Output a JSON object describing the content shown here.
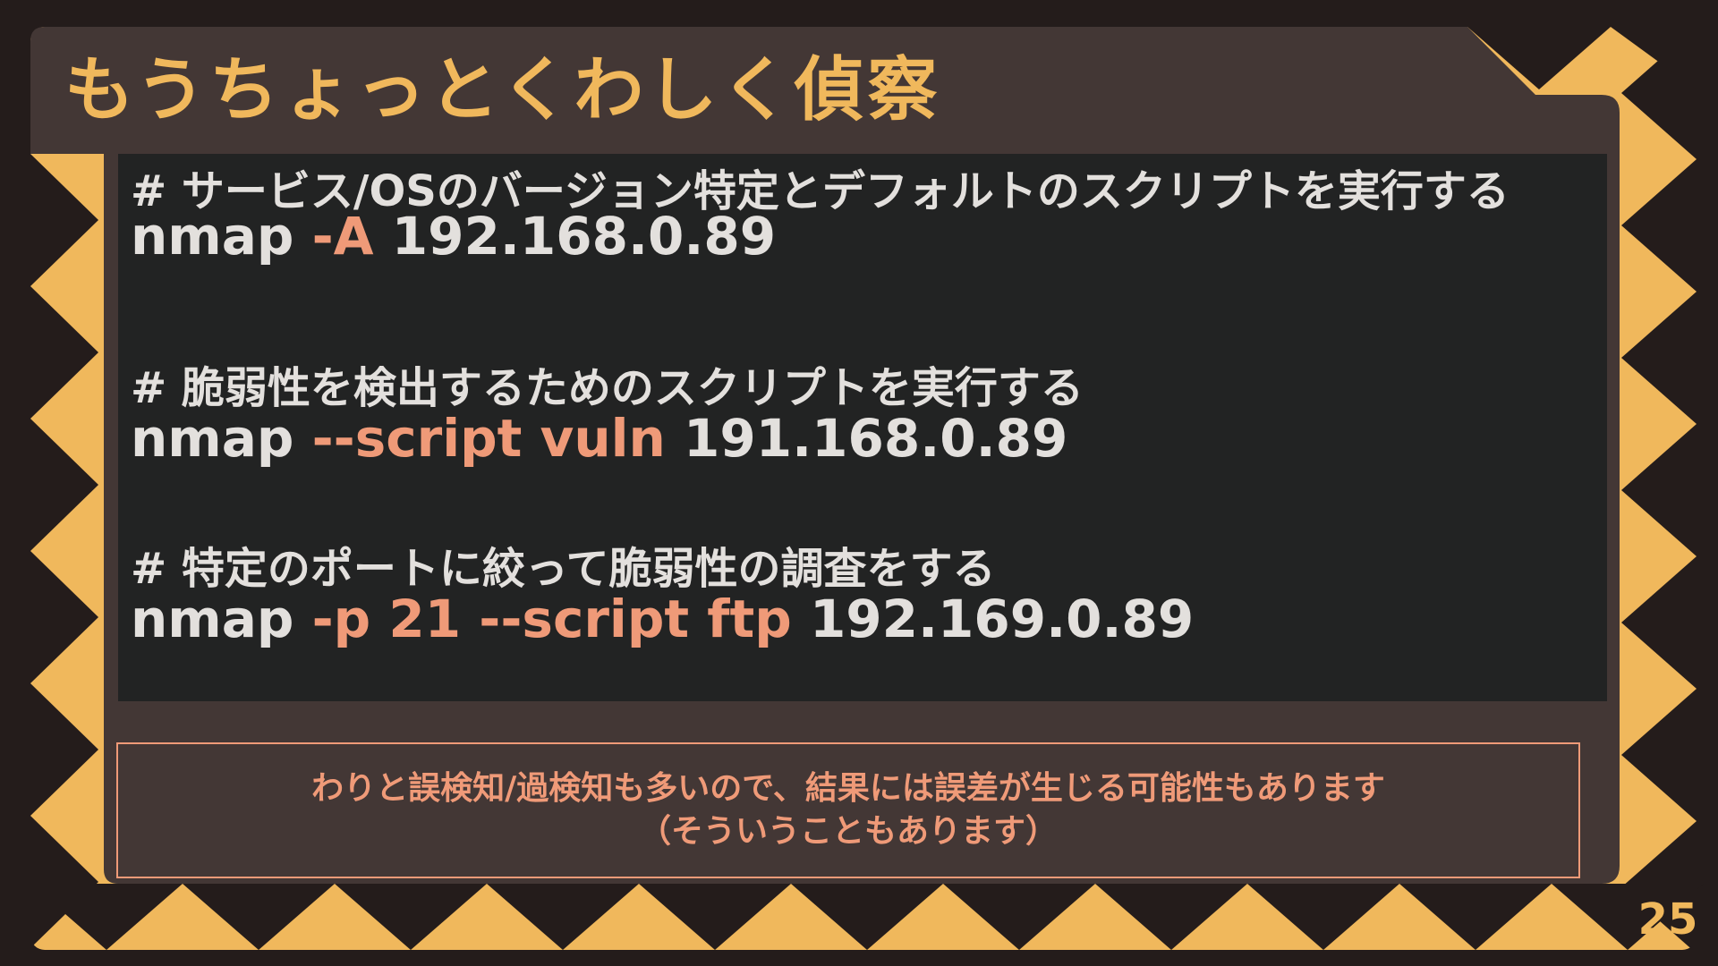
{
  "slide": {
    "title": "もうちょっとくわしく偵察",
    "page_number": "25",
    "colors": {
      "accent": "#f0b85c",
      "highlight": "#ef9a78",
      "panel": "#433735",
      "code_bg": "#222323",
      "text": "#e3e0dd",
      "dark": "#241c1b"
    }
  },
  "code": {
    "block1": {
      "comment": "# サービス/OSのバージョン特定とデフォルトのスクリプトを実行する",
      "cmd": "nmap",
      "option": "-A",
      "target": "192.168.0.89"
    },
    "block2": {
      "comment": "# 脆弱性を検出するためのスクリプトを実行する",
      "cmd": "nmap",
      "option": "--script vuln",
      "target": "191.168.0.89"
    },
    "block3": {
      "comment": "# 特定のポートに絞って脆弱性の調査をする",
      "cmd": "nmap",
      "option": "-p 21 --script ftp",
      "target": "192.169.0.89"
    }
  },
  "note": {
    "line1": "わりと誤検知/過検知も多いので、結果には誤差が生じる可能性もあります",
    "line2": "（そういうこともあります）"
  }
}
